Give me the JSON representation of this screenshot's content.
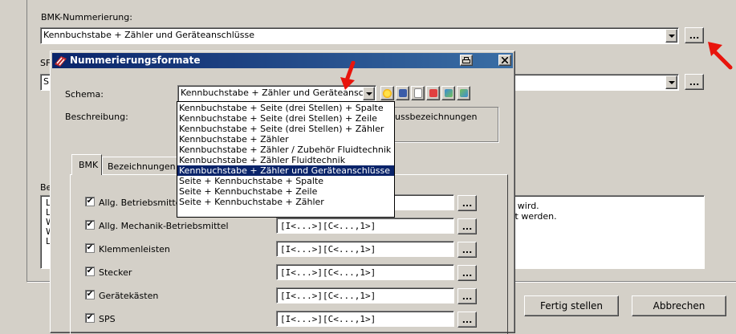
{
  "main": {
    "bmk_label": "BMK-Nummerierung:",
    "bmk_value": "Kennbuchstabe + Zähler und Geräteanschlüsse",
    "sf_label": "SF",
    "sf_value_prefix": "S",
    "desc_label_prefix": "Be",
    "desc_lines": [
      "t wird.",
      "rt werden."
    ],
    "desc_left_letters": [
      "L",
      "L",
      "W",
      "W",
      "L"
    ],
    "dots_label": "...",
    "finish_button": "Fertig stellen",
    "cancel_button": "Abbrechen"
  },
  "dialog": {
    "title": "Nummerierungsformate",
    "schema_label": "Schema:",
    "schema_value": "Kennbuchstabe + Zähler und Geräteansch",
    "beschreibung_label": "Beschreibung:",
    "beschreibung_partial": "hlussbezeichnungen",
    "tabs": [
      "BMK",
      "Bezeichnungen"
    ],
    "dropdown_options": [
      "Kennbuchstabe + Seite (drei Stellen) + Spalte",
      "Kennbuchstabe + Seite (drei Stellen) + Zeile",
      "Kennbuchstabe + Seite (drei Stellen) + Zähler",
      "Kennbuchstabe + Zähler",
      "Kennbuchstabe + Zähler / Zubehör Fluidtechnik",
      "Kennbuchstabe + Zähler Fluidtechnik",
      "Kennbuchstabe + Zähler und Geräteanschlüsse",
      "Seite + Kennbuchstabe + Spalte",
      "Seite + Kennbuchstabe + Zeile",
      "Seite + Kennbuchstabe + Zähler"
    ],
    "selected_index": 6,
    "rows": [
      {
        "label": "Allg. Betriebsmittel",
        "value": "",
        "checked": "✔"
      },
      {
        "label": "Allg. Mechanik-Betriebsmittel",
        "value": "[I<...>][C<...,1>]",
        "checked": "✔"
      },
      {
        "label": "Klemmenleisten",
        "value": "[I<...>][C<...,1>]",
        "checked": "✔"
      },
      {
        "label": "Stecker",
        "value": "[I<...>][C<...,1>]",
        "checked": "✔"
      },
      {
        "label": "Gerätekästen",
        "value": "[I<...>][C<...,1>]",
        "checked": "✔"
      },
      {
        "label": "SPS",
        "value": "[I<...>][C<...,1>]",
        "checked": "✔"
      }
    ]
  },
  "colors": {
    "title_bar": "#0a246a",
    "selection": "#0a246a",
    "arrow": "#e8140c"
  }
}
